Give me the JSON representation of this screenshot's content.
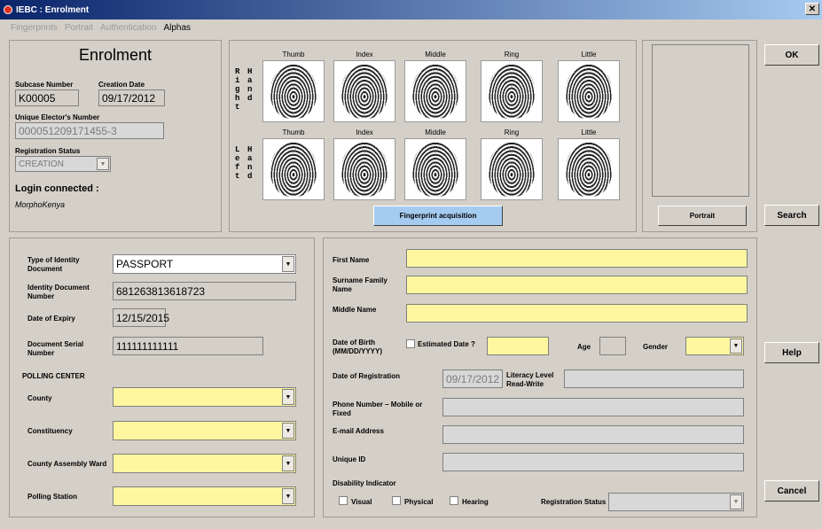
{
  "window": {
    "title": "IEBC : Enrolment",
    "close_icon": "close-icon"
  },
  "menu": {
    "items": [
      {
        "label": "Fingerprints",
        "dim": true
      },
      {
        "label": "Portrait",
        "dim": true
      },
      {
        "label": "Authentication",
        "dim": true
      },
      {
        "label": "Alphas",
        "dim": false
      }
    ]
  },
  "enrolment": {
    "heading": "Enrolment",
    "subcase_label": "Subcase Number",
    "subcase_value": "K00005",
    "creation_label": "Creation Date",
    "creation_value": "09/17/2012",
    "elector_label": "Unique Elector's Number",
    "elector_value": "000051209171455-3",
    "reg_status_label": "Registration Status",
    "reg_status_value": "CREATION",
    "login_label": "Login connected :",
    "login_value": "MorphoKenya"
  },
  "fingerprints": {
    "right_hand_col1": "Right",
    "right_hand_col2": "Hand",
    "left_hand_col1": "Left",
    "left_hand_col2": "Hand",
    "right_fingers": [
      "Thumb",
      "Index",
      "Middle",
      "Ring",
      "Little"
    ],
    "left_fingers": [
      "Thumb",
      "Index",
      "Middle",
      "Ring",
      "Little"
    ],
    "acquisition_button": "Fingerprint acquisition"
  },
  "portrait": {
    "button": "Portrait"
  },
  "side_buttons": {
    "ok": "OK",
    "search": "Search",
    "help": "Help",
    "cancel": "Cancel"
  },
  "identity": {
    "doc_type_label": "Type of Identity Document",
    "doc_type_value": "PASSPORT",
    "doc_number_label": "Identity Document Number",
    "doc_number_value": "681263813618723",
    "expiry_label": "Date of Expiry",
    "expiry_value": "12/15/2015",
    "serial_label": "Document Serial Number",
    "serial_value": "111111111111",
    "polling_center_label": "POLLING CENTER",
    "county_label": "County",
    "constituency_label": "Constituency",
    "ward_label": "County Assembly Ward",
    "station_label": "Polling Station"
  },
  "person": {
    "first_name_label": "First Name",
    "surname_label": "Surname Family Name",
    "middle_name_label": "Middle Name",
    "dob_label": "Date of Birth (MM/DD/YYYY)",
    "estimated_label": "Estimated Date ?",
    "age_label": "Age",
    "gender_label": "Gender",
    "registration_date_label": "Date of Registration",
    "registration_date_value": "09/17/2012",
    "literacy_label": "Literacy Level Read-Write",
    "phone_label": "Phone Number – Mobile or Fixed",
    "email_label": "E-mail Address",
    "unique_id_label": "Unique ID",
    "disability_label": "Disability Indicator",
    "visual_label": "Visual",
    "physical_label": "Physical",
    "hearing_label": "Hearing",
    "registration_status_label": "Registration Status"
  },
  "colors": {
    "required": "#fff7a0",
    "title": "#0a246a",
    "button_blue": "#a6cbf0"
  }
}
